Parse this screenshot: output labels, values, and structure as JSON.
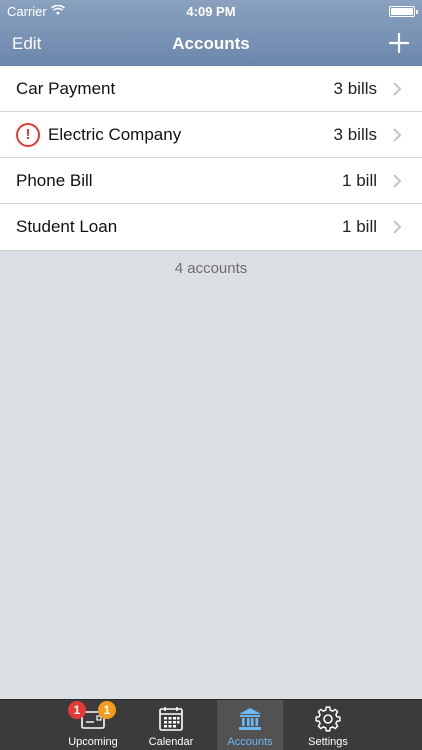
{
  "status_bar": {
    "carrier": "Carrier",
    "time": "4:09 PM"
  },
  "nav_bar": {
    "edit_label": "Edit",
    "title": "Accounts",
    "add_icon": "plus-icon"
  },
  "accounts": [
    {
      "name": "Car Payment",
      "count": "3 bills",
      "alert": false
    },
    {
      "name": "Electric Company",
      "count": "3 bills",
      "alert": true,
      "alert_symbol": "!"
    },
    {
      "name": "Phone Bill",
      "count": "1 bill",
      "alert": false
    },
    {
      "name": "Student Loan",
      "count": "1 bill",
      "alert": false
    }
  ],
  "footer": {
    "count_text": "4 accounts"
  },
  "tab_bar": {
    "selected": "Accounts",
    "tabs": [
      {
        "label": "Upcoming",
        "icon": "upcoming-icon",
        "badges": [
          "1",
          "1"
        ]
      },
      {
        "label": "Calendar",
        "icon": "calendar-icon"
      },
      {
        "label": "Accounts",
        "icon": "bank-icon"
      },
      {
        "label": "Settings",
        "icon": "gear-icon"
      }
    ]
  },
  "colors": {
    "nav_bar": "#7b93b5",
    "background": "#dbdee3",
    "alert": "#e53935",
    "badge_red": "#e53935",
    "badge_orange": "#f49b1c",
    "tab_selected": "#6bb8f5",
    "tab_bar": "#3b3b3b"
  }
}
